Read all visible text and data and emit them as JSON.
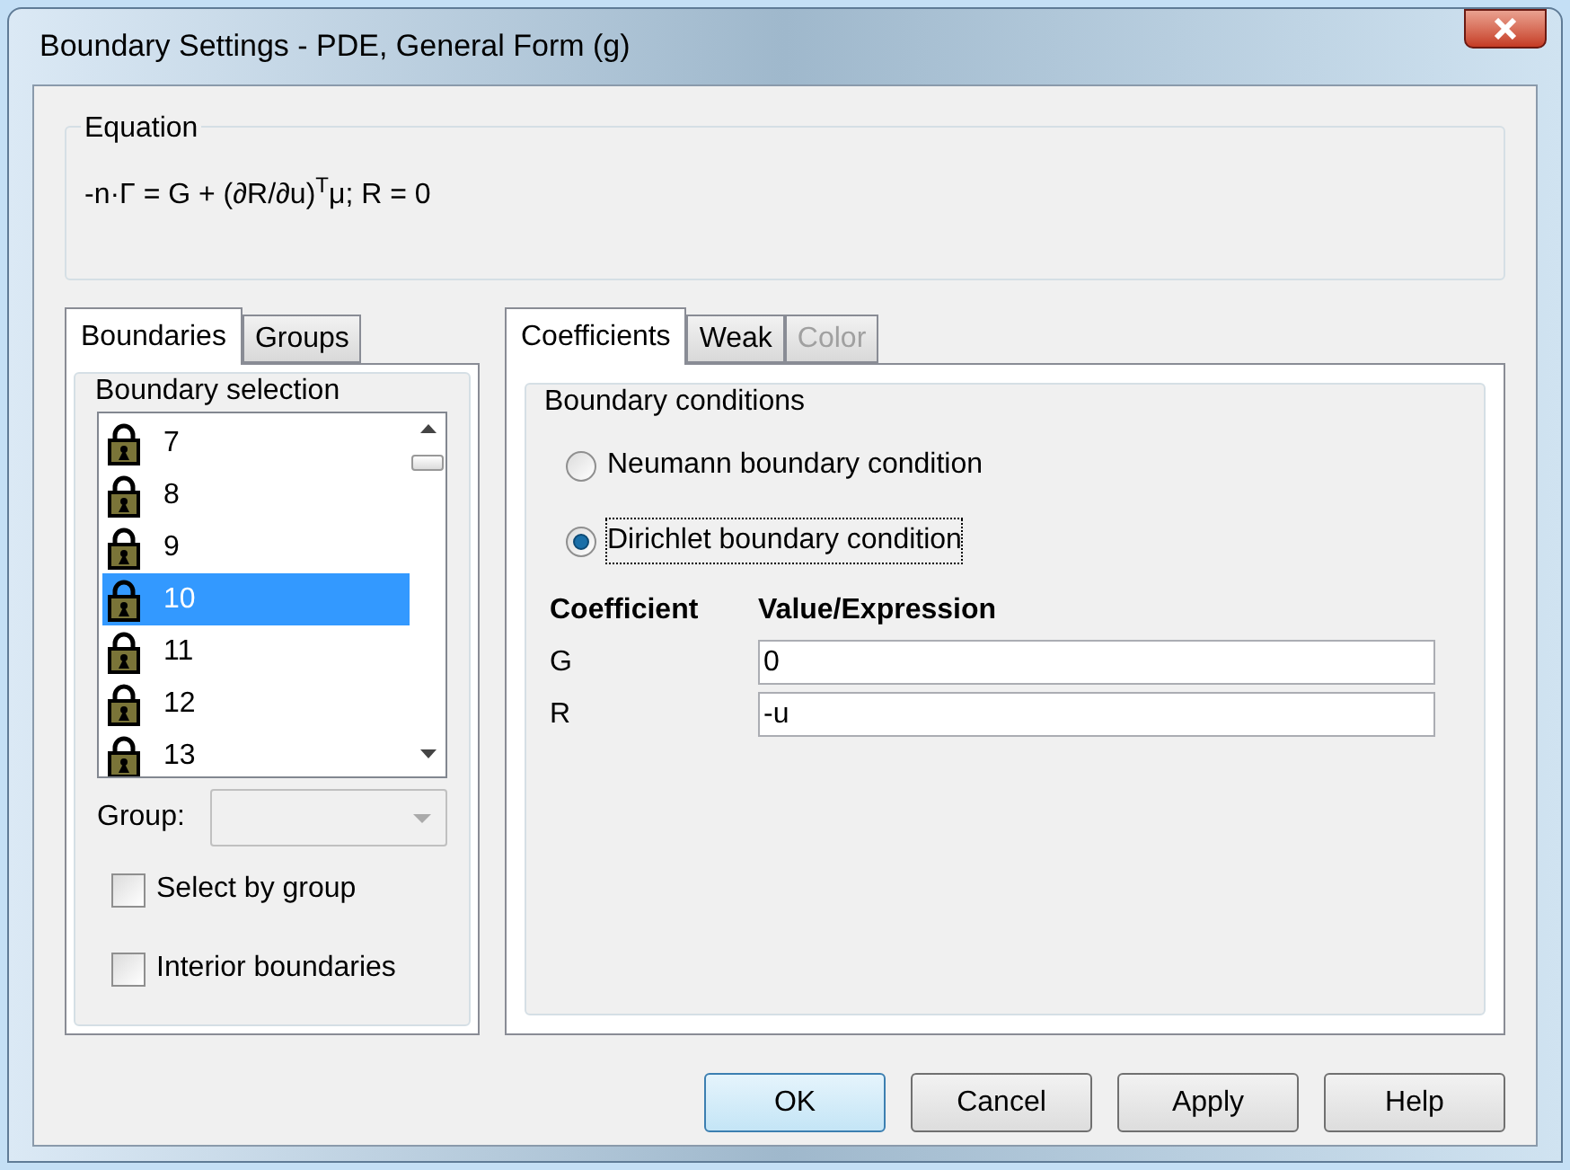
{
  "window": {
    "title": "Boundary Settings - PDE, General Form (g)"
  },
  "equation": {
    "label": "Equation",
    "text": "-n·Γ = G + (∂R/∂u)$^{T}$μ; R = 0"
  },
  "left_tabs": [
    {
      "label": "Boundaries",
      "selected": true,
      "disabled": false
    },
    {
      "label": "Groups",
      "selected": false,
      "disabled": false
    }
  ],
  "boundary_selection": {
    "label": "Boundary selection",
    "items": [
      {
        "label": "7",
        "selected": false
      },
      {
        "label": "8",
        "selected": false
      },
      {
        "label": "9",
        "selected": false
      },
      {
        "label": "10",
        "selected": true
      },
      {
        "label": "11",
        "selected": false
      },
      {
        "label": "12",
        "selected": false
      },
      {
        "label": "13",
        "selected": false
      }
    ],
    "group_label": "Group:",
    "checkboxes": [
      {
        "label": "Select by group",
        "checked": false
      },
      {
        "label": "Interior boundaries",
        "checked": false
      }
    ]
  },
  "right_tabs": [
    {
      "label": "Coefficients",
      "selected": true,
      "disabled": false
    },
    {
      "label": "Weak",
      "selected": false,
      "disabled": false
    },
    {
      "label": "Color",
      "selected": false,
      "disabled": true
    }
  ],
  "boundary_conditions": {
    "label": "Boundary conditions",
    "options": [
      {
        "label": "Neumann boundary condition",
        "selected": false
      },
      {
        "label": "Dirichlet boundary condition",
        "selected": true
      }
    ],
    "columns": [
      "Coefficient",
      "Value/Expression"
    ],
    "rows": [
      {
        "name": "G",
        "value": "0"
      },
      {
        "name": "R",
        "value": "-u"
      }
    ]
  },
  "buttons": [
    {
      "label": "OK",
      "default": true
    },
    {
      "label": "Cancel",
      "default": false
    },
    {
      "label": "Apply",
      "default": false
    },
    {
      "label": "Help",
      "default": false
    }
  ]
}
